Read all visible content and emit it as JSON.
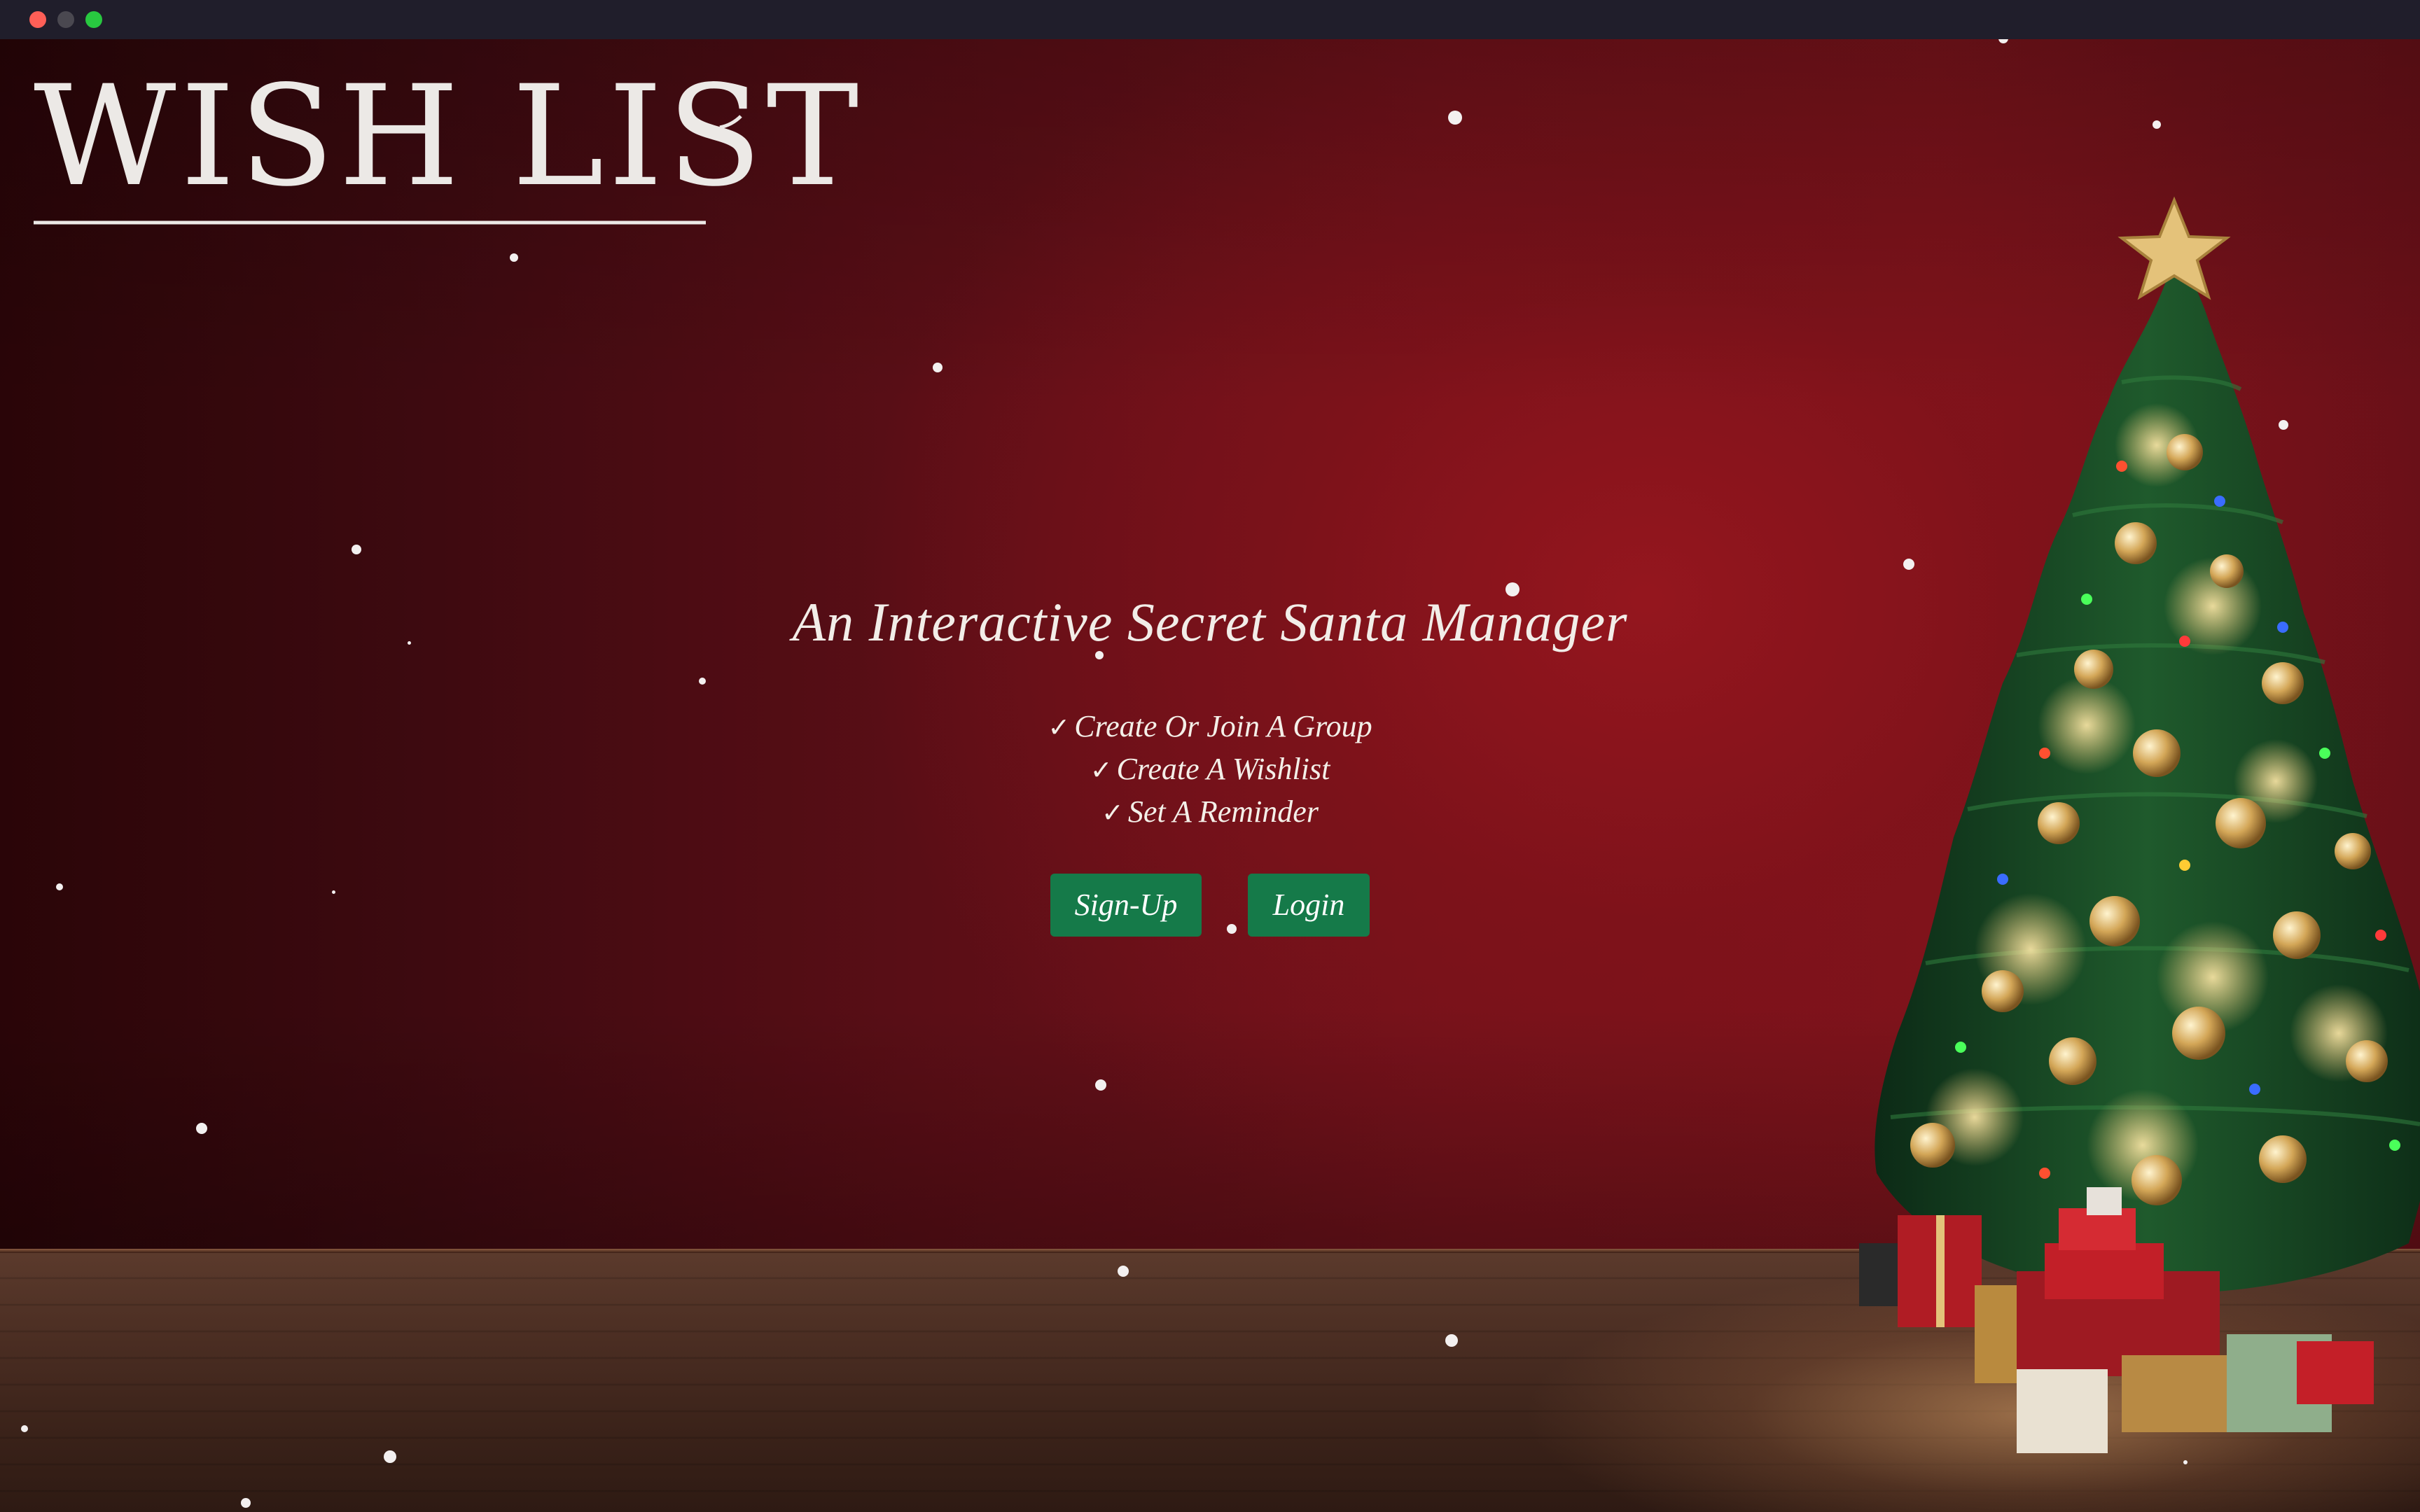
{
  "window": {
    "controls": [
      "close",
      "minimize",
      "maximize"
    ]
  },
  "brand": {
    "logo_text": "WISH LIST"
  },
  "hero": {
    "tagline": "An Interactive Secret Santa Manager",
    "features": [
      {
        "icon": "checkmark-icon",
        "check": "✓",
        "label": "Create Or Join A Group"
      },
      {
        "icon": "checkmark-icon",
        "check": "✓",
        "label": "Create A Wishlist"
      },
      {
        "icon": "checkmark-icon",
        "check": "✓",
        "label": "Set A Reminder"
      }
    ]
  },
  "actions": {
    "signup_label": "Sign-Up",
    "login_label": "Login"
  },
  "colors": {
    "wall_red": "#7d141c",
    "button_green": "#157a49",
    "text_light": "#f2ede8"
  }
}
